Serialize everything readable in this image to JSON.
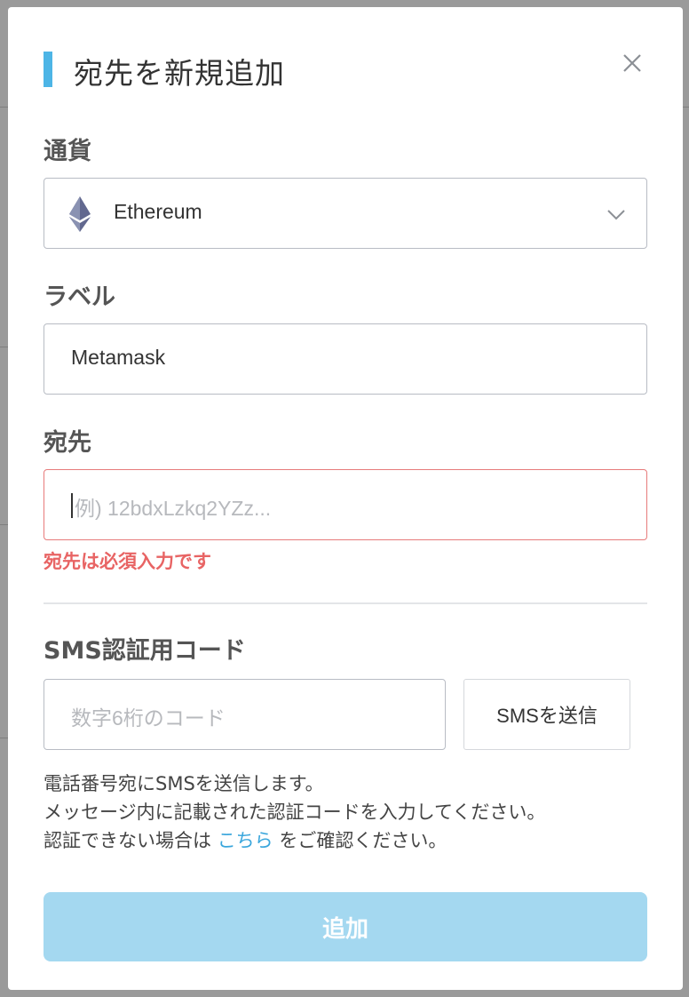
{
  "modal": {
    "title": "宛先を新規追加",
    "close_icon": "close-icon"
  },
  "currency": {
    "label": "通貨",
    "selected": "Ethereum",
    "icon": "ethereum-icon"
  },
  "label_field": {
    "label": "ラベル",
    "value": "Metamask"
  },
  "address": {
    "label": "宛先",
    "placeholder": "例) 12bdxLzkq2YZz...",
    "error": "宛先は必須入力です"
  },
  "sms": {
    "label": "SMS認証用コード",
    "placeholder": "数字6桁のコード",
    "send_button": "SMSを送信",
    "help_line1": "電話番号宛にSMSを送信します。",
    "help_line2": "メッセージ内に記載された認証コードを入力してください。",
    "help_line3_prefix": "認証できない場合は",
    "help_link": "こちら",
    "help_line3_suffix": "をご確認ください。"
  },
  "submit": {
    "label": "追加"
  },
  "colors": {
    "accent": "#4db5e6",
    "error": "#e86464",
    "submit_bg": "#a4d8f0",
    "link": "#3aa6dc"
  }
}
